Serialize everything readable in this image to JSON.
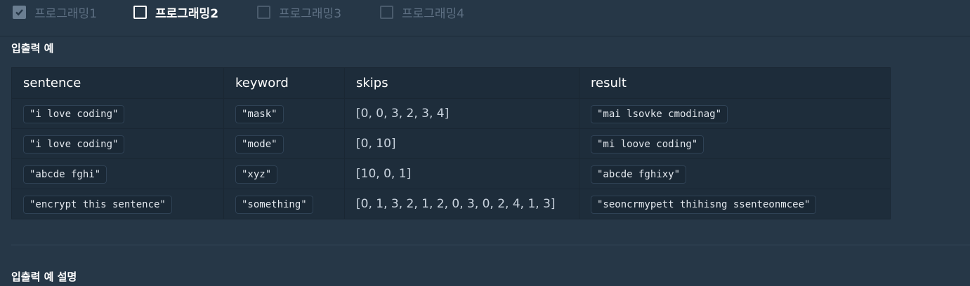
{
  "tabs": [
    {
      "label": "프로그래밍1",
      "checked": true,
      "active": false
    },
    {
      "label": "프로그래밍2",
      "checked": false,
      "active": true
    },
    {
      "label": "프로그래밍3",
      "checked": false,
      "active": false
    },
    {
      "label": "프로그래밍4",
      "checked": false,
      "active": false
    }
  ],
  "section": {
    "title": "입출력 예",
    "table": {
      "headers": [
        "sentence",
        "keyword",
        "skips",
        "result"
      ],
      "rows": [
        [
          "\"i love coding\"",
          "\"mask\"",
          "[0, 0, 3, 2, 3, 4]",
          "\"mai lsovke cmodinag\""
        ],
        [
          "\"i love coding\"",
          "\"mode\"",
          "[0, 10]",
          "\"mi loove coding\""
        ],
        [
          "\"abcde fghi\"",
          "\"xyz\"",
          "[10, 0, 1]",
          "\"abcde fghixy\""
        ],
        [
          "\"encrypt this sentence\"",
          "\"something\"",
          "[0, 1, 3, 2, 1, 2, 0, 3, 0, 2, 4, 1, 3]",
          "\"seoncrmypett thihisng ssenteonmcee\""
        ]
      ]
    }
  },
  "section2": {
    "title": "입출력 예 설명"
  },
  "icons": {
    "checkbox_checked": "check-icon"
  }
}
